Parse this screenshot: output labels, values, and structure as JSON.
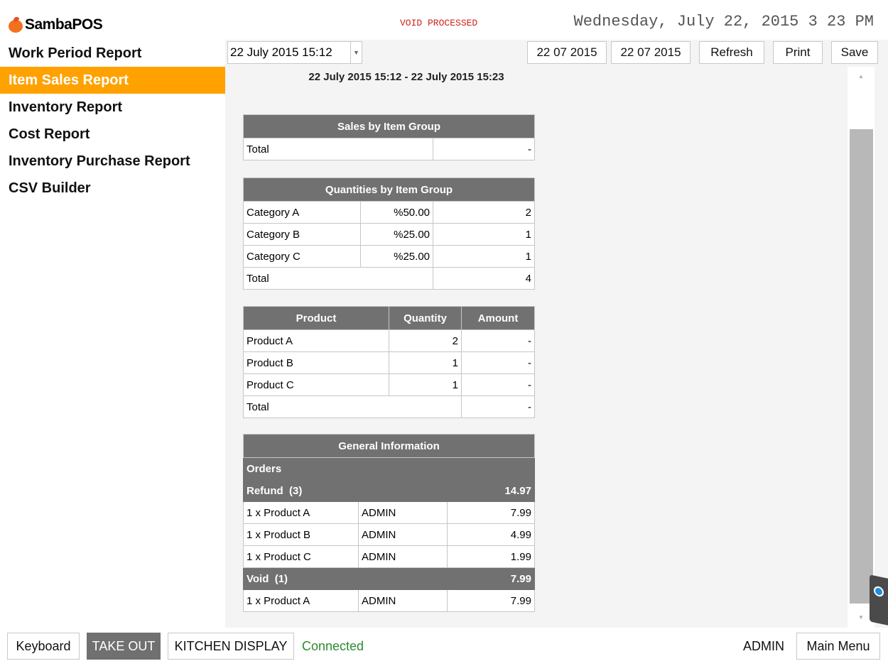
{
  "header": {
    "app_name": "SambaPOS",
    "status_message": "VOID PROCESSED",
    "datetime": "Wednesday, July 22, 2015 3 23 PM"
  },
  "sidebar": {
    "items": [
      {
        "label": "Work Period Report",
        "active": false
      },
      {
        "label": "Item Sales Report",
        "active": true
      },
      {
        "label": "Inventory Report",
        "active": false
      },
      {
        "label": "Cost Report",
        "active": false
      },
      {
        "label": "Inventory Purchase Report",
        "active": false
      },
      {
        "label": "CSV Builder",
        "active": false
      }
    ]
  },
  "toolbar": {
    "work_period_value": "22 July 2015 15:12",
    "start_date": "22 07 2015",
    "end_date": "22 07 2015",
    "refresh_label": "Refresh",
    "print_label": "Print",
    "save_label": "Save"
  },
  "report": {
    "range_caption": "22 July 2015 15:12 - 22 July 2015 15:23",
    "sales_by_group": {
      "title": "Sales by Item Group",
      "total_label": "Total",
      "total_value": "-"
    },
    "quantities_by_group": {
      "title": "Quantities by Item Group",
      "rows": [
        {
          "name": "Category A",
          "percent": "%50.00",
          "qty": "2"
        },
        {
          "name": "Category B",
          "percent": "%25.00",
          "qty": "1"
        },
        {
          "name": "Category C",
          "percent": "%25.00",
          "qty": "1"
        }
      ],
      "total_label": "Total",
      "total_value": "4"
    },
    "products": {
      "headers": {
        "product": "Product",
        "quantity": "Quantity",
        "amount": "Amount"
      },
      "rows": [
        {
          "name": "Product A",
          "qty": "2",
          "amount": "-"
        },
        {
          "name": "Product B",
          "qty": "1",
          "amount": "-"
        },
        {
          "name": "Product C",
          "qty": "1",
          "amount": "-"
        }
      ],
      "total_label": "Total",
      "total_value": "-"
    },
    "general": {
      "title": "General Information",
      "orders_label": "Orders",
      "refund_label": "Refund  (3)",
      "refund_total": "14.97",
      "refund_rows": [
        {
          "item": "1 x Product A",
          "user": "ADMIN",
          "amount": "7.99"
        },
        {
          "item": "1 x Product B",
          "user": "ADMIN",
          "amount": "4.99"
        },
        {
          "item": "1 x Product C",
          "user": "ADMIN",
          "amount": "1.99"
        }
      ],
      "void_label": "Void  (1)",
      "void_total": "7.99",
      "void_rows": [
        {
          "item": "1 x Product A",
          "user": "ADMIN",
          "amount": "7.99"
        }
      ]
    }
  },
  "bottom": {
    "keyboard_label": "Keyboard",
    "takeout_label": "TAKE OUT",
    "kitchen_label": "KITCHEN DISPLAY",
    "connection_status": "Connected",
    "user": "ADMIN",
    "main_menu_label": "Main Menu"
  },
  "colors": {
    "active_menu": "#ffa200",
    "table_header": "#717171",
    "status_red": "#d0201c",
    "connected_green": "#2e8b2e"
  }
}
